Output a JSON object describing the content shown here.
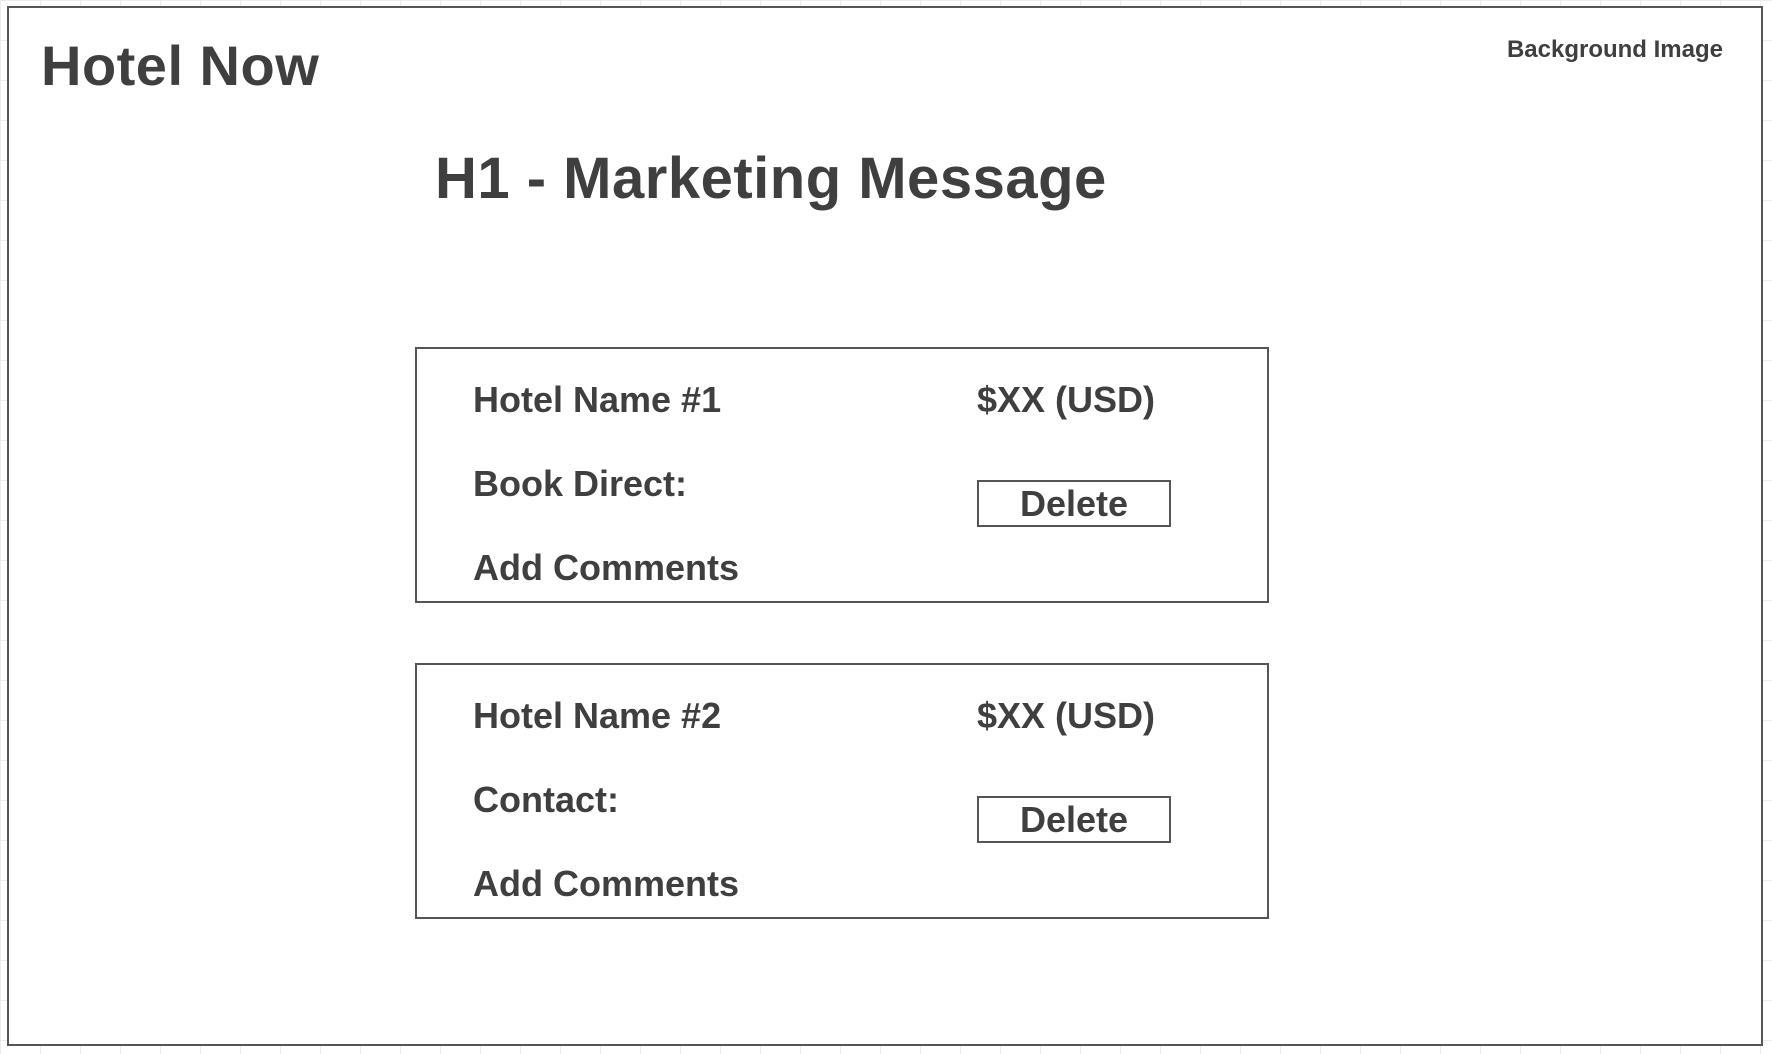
{
  "header": {
    "brand": "Hotel Now",
    "background_label": "Background Image"
  },
  "main": {
    "headline": "H1 - Marketing Message",
    "results": [
      {
        "name": "Hotel Name #1",
        "price": "$XX (USD)",
        "contact_label": "Book Direct:",
        "delete_label": "Delete",
        "comments_label": "Add Comments"
      },
      {
        "name": "Hotel Name #2",
        "price": "$XX (USD)",
        "contact_label": "Contact:",
        "delete_label": "Delete",
        "comments_label": "Add Comments"
      }
    ]
  },
  "colors": {
    "text": "#3f3f3f",
    "border": "#555555",
    "background": "#ffffff"
  }
}
